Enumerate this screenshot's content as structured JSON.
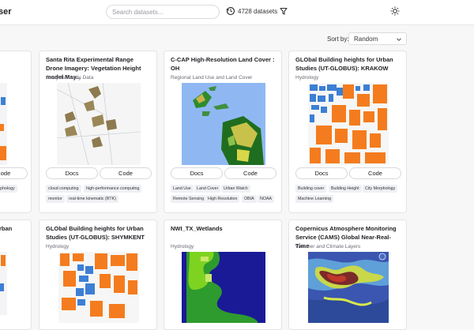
{
  "header": {
    "brand": "ser",
    "search_placeholder": "Search datasets...",
    "dataset_count": "4728 datasets"
  },
  "sort": {
    "label": "Sort by:",
    "value": "Random"
  },
  "cards": [
    {
      "title": "",
      "category": "",
      "docs": "",
      "code": "ode",
      "tags": [
        "Morphology"
      ]
    },
    {
      "title": "Santa Rita Experimental Range Drone Imagery: Vegetation Height model May...",
      "category": "Analysis Ready Data",
      "docs": "Docs",
      "code": "Code",
      "tags": [
        "cloud computing",
        "high-performance computing",
        "monitor",
        "real-time kinematic (RTK)"
      ]
    },
    {
      "title": "C-CAP High-Resolution Land Cover : OH",
      "category": "Regional Land Use and Land Cover",
      "docs": "Docs",
      "code": "Code",
      "tags": [
        "Land Use",
        "Land Cover",
        "Urban Watch",
        "Remote Sensing",
        "High Resolution",
        "OBIA",
        "NOAA"
      ]
    },
    {
      "title": "GLObal Building heights for Urban Studies (UT-GLOBUS): KRAKOW",
      "category": "Hydrology",
      "docs": "Docs",
      "code": "Code",
      "tags": [
        "Building cover",
        "Building Height",
        "City Morphology",
        "Machine Learning"
      ]
    },
    {
      "title": "rban",
      "category": "",
      "docs": "",
      "code": "",
      "tags": []
    },
    {
      "title": "GLObal Building heights for Urban Studies (UT-GLOBUS): SHYMKENT",
      "category": "Hydrology",
      "docs": "",
      "code": "",
      "tags": []
    },
    {
      "title": "NWI_TX_Wetlands",
      "category": "Hydrology",
      "docs": "",
      "code": "",
      "tags": []
    },
    {
      "title": "Copernicus Atmosphere Monitoring Service (CAMS) Global Near-Real-Time",
      "category": "Weather and Climate Layers",
      "docs": "",
      "code": "",
      "tags": []
    }
  ],
  "colors": {
    "accent_orange": "#f47c1e",
    "building_blue": "#3c7fd4",
    "ocean": "#8fb8f3",
    "water_dark": "#1a1a96"
  }
}
